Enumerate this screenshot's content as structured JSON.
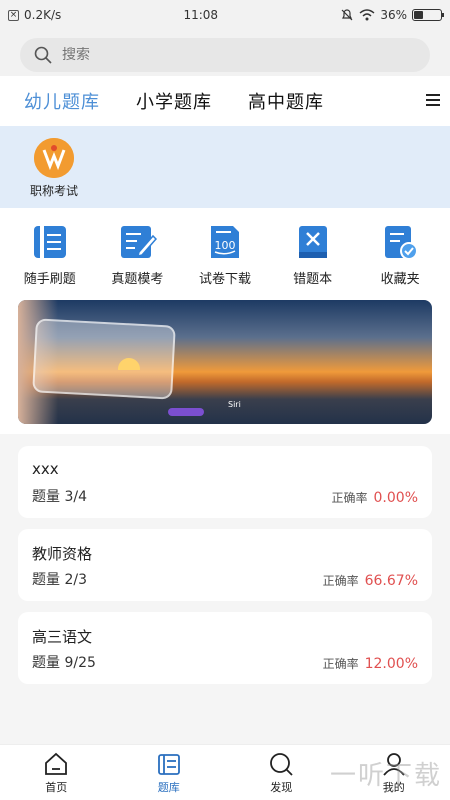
{
  "status_bar": {
    "speed": "0.2K/s",
    "time": "11:08",
    "battery": "36%",
    "battery_level": 0.36
  },
  "search": {
    "placeholder": "搜索"
  },
  "tabs": [
    {
      "label": "幼儿题库",
      "active": true
    },
    {
      "label": "小学题库",
      "active": false
    },
    {
      "label": "高中题库",
      "active": false
    }
  ],
  "exam_category": {
    "label": "职称考试"
  },
  "quick_actions": [
    {
      "label": "随手刷题",
      "icon": "book-icon"
    },
    {
      "label": "真题模考",
      "icon": "edit-doc-icon"
    },
    {
      "label": "试卷下载",
      "icon": "paper-100-icon"
    },
    {
      "label": "错题本",
      "icon": "wrong-book-icon"
    },
    {
      "label": "收藏夹",
      "icon": "favorites-icon"
    }
  ],
  "banner": {
    "caption": "Siri"
  },
  "question_banks": [
    {
      "title": "xxx",
      "count": "题量 3/4",
      "rate_label": "正确率",
      "rate": "0.00%"
    },
    {
      "title": "教师资格",
      "count": "题量 2/3",
      "rate_label": "正确率",
      "rate": "66.67%"
    },
    {
      "title": "高三语文",
      "count": "题量 9/25",
      "rate_label": "正确率",
      "rate": "12.00%"
    }
  ],
  "bottom_nav": [
    {
      "label": "首页",
      "icon": "home-icon",
      "active": false
    },
    {
      "label": "题库",
      "icon": "question-bank-icon",
      "active": true
    },
    {
      "label": "发现",
      "icon": "discover-icon",
      "active": false
    },
    {
      "label": "我的",
      "icon": "profile-icon",
      "active": false
    }
  ],
  "watermark": "一听下载",
  "colors": {
    "accent": "#4d8fd6",
    "rate": "#e05050",
    "band": "#e1ecf9"
  }
}
